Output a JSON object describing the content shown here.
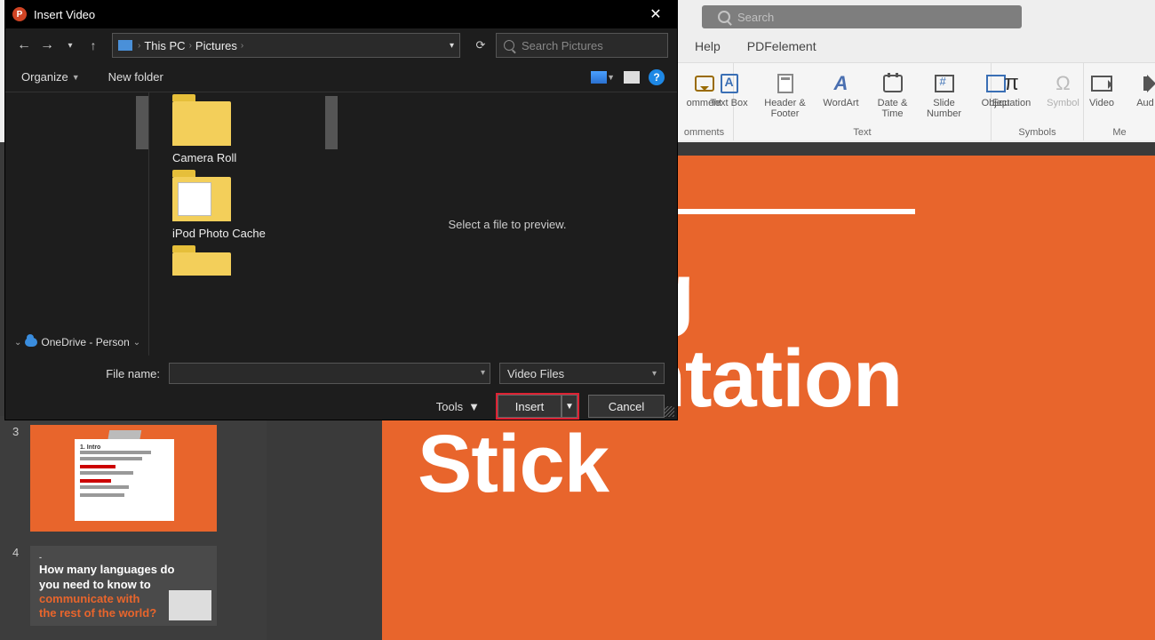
{
  "ribbon": {
    "search_placeholder": "Search",
    "tabs": {
      "help": "Help",
      "pdfelement": "PDFelement"
    },
    "groups": {
      "comments": {
        "label": "omments",
        "items": {
          "comment": "omment"
        }
      },
      "text": {
        "label": "Text",
        "items": {
          "textbox": "Text Box",
          "header": "Header & Footer",
          "wordart": "WordArt",
          "datetime": "Date & Time",
          "slidenum": "Slide Number",
          "object": "Object"
        }
      },
      "symbols": {
        "label": "Symbols",
        "items": {
          "equation": "Equation",
          "symbol": "Symbol"
        }
      },
      "media": {
        "label": "Me",
        "items": {
          "video": "Video",
          "audio": "Aud"
        }
      }
    }
  },
  "slide": {
    "line1": "Making",
    "line2": "Presentation",
    "line3": "Stick"
  },
  "thumbs": {
    "n3": "3",
    "n4": "4",
    "t3_title": "1. Intro",
    "t4_l1": "How many languages do",
    "t4_l2": "you need to know to",
    "t4_l3": "communicate with",
    "t4_l4": "the rest of the world?"
  },
  "dialog": {
    "title": "Insert Video",
    "path": {
      "root": "This PC",
      "folder": "Pictures"
    },
    "search_placeholder": "Search Pictures",
    "toolbar": {
      "organize": "Organize",
      "newfolder": "New folder"
    },
    "tree": {
      "onedrive": "OneDrive - Person"
    },
    "files": {
      "camera": "Camera Roll",
      "ipod": "iPod Photo Cache"
    },
    "preview_msg": "Select a file to preview.",
    "filename_label": "File name:",
    "filetype": "Video Files",
    "tools": "Tools",
    "insert": "Insert",
    "cancel": "Cancel"
  }
}
